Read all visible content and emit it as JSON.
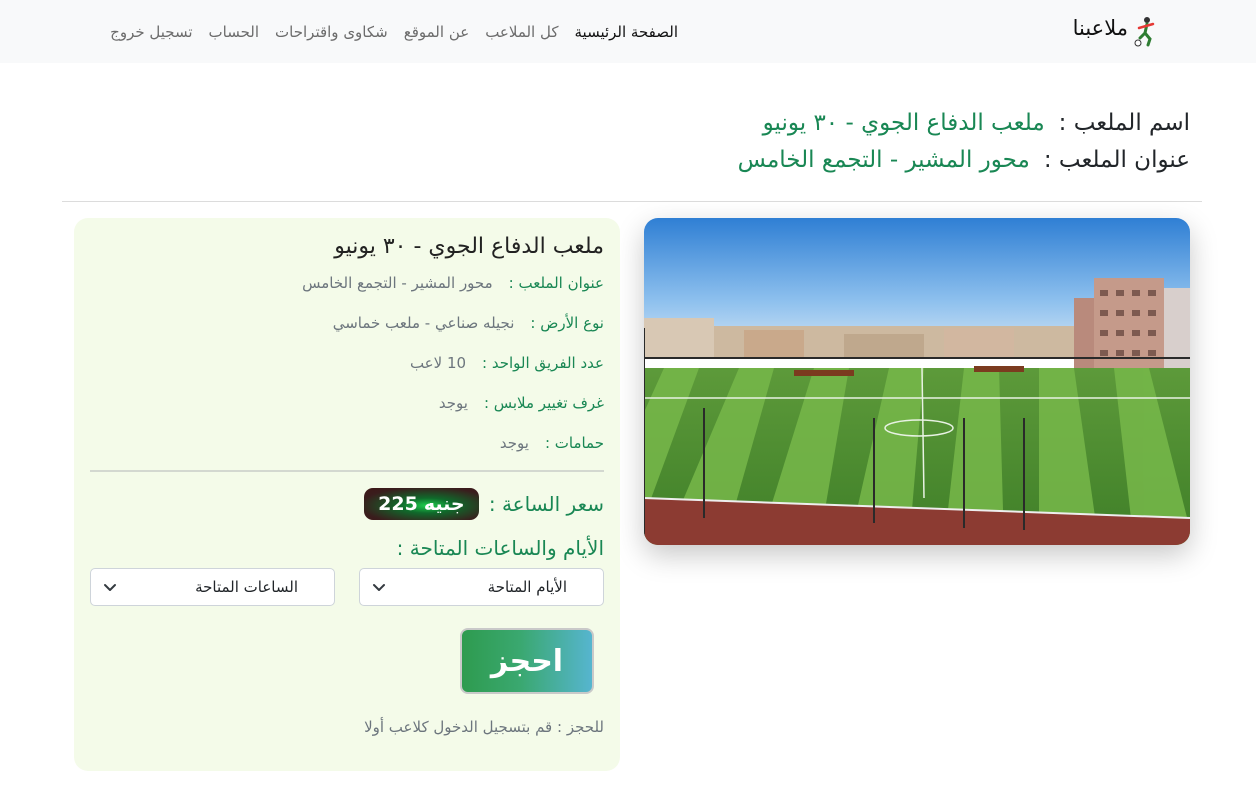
{
  "brand": {
    "name": "ملاعبنا"
  },
  "nav": {
    "home": "الصفحة الرئيسية",
    "all_fields": "كل الملاعب",
    "about": "عن الموقع",
    "complaints": "شكاوى واقتراحات",
    "account": "الحساب",
    "logout": "تسجيل خروج"
  },
  "header": {
    "name_label": "اسم الملعب :",
    "name_value": "ملعب الدفاع الجوي - ٣٠ يونيو",
    "address_label": "عنوان الملعب :",
    "address_value": "محور المشير - التجمع الخامس"
  },
  "card": {
    "title": "ملعب الدفاع الجوي - ٣٠ يونيو",
    "details": [
      {
        "key": "عنوان الملعب :",
        "value": "محور المشير - التجمع الخامس"
      },
      {
        "key": "نوع الأرض :",
        "value": "نجيله صناعي - ملعب خماسي"
      },
      {
        "key": "عدد الفريق الواحد :",
        "value": "10 لاعب"
      },
      {
        "key": "غرف تغيير ملابس :",
        "value": "يوجد"
      },
      {
        "key": "حمامات :",
        "value": "يوجد"
      }
    ],
    "price_label": "سعر الساعة :",
    "price_value": "225",
    "price_unit": "جنيه",
    "days_hours_label": "الأيام والساعات المتاحة :",
    "days_select": "الأيام المتاحة",
    "hours_select": "الساعات المتاحة",
    "book_button": "احجز",
    "login_note": "للحجز : قم بتسجيل الدخول كلاعب أولا"
  },
  "colors": {
    "accent_green": "#198754",
    "navbar_bg": "#f8f9fa",
    "card_bg": "#f4fbe9"
  }
}
